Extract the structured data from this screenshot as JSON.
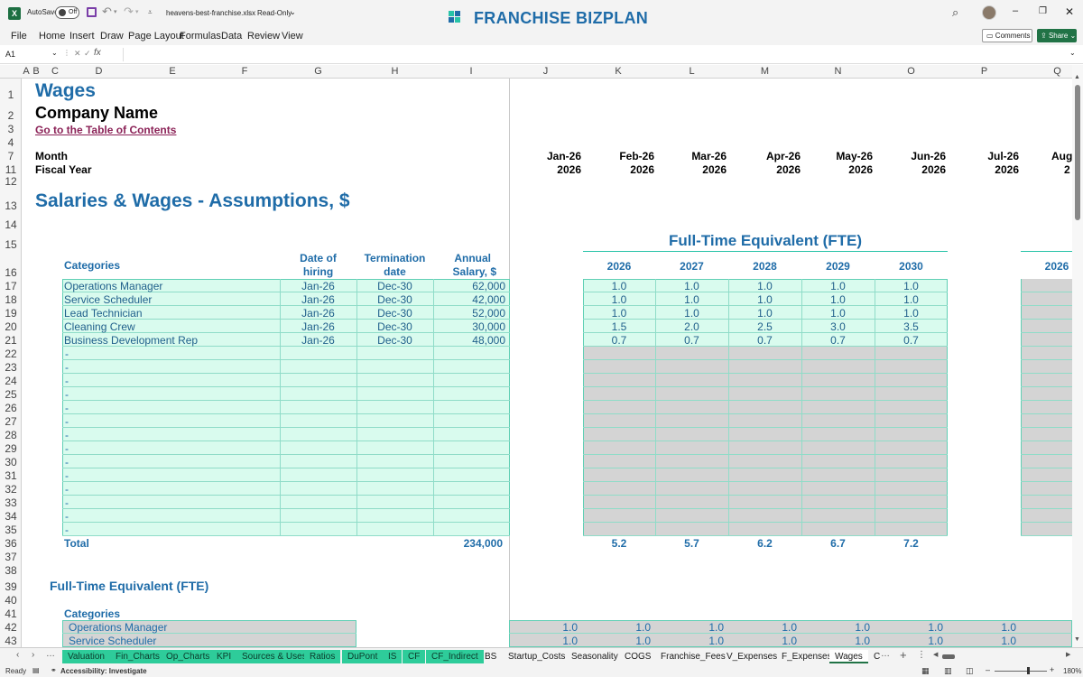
{
  "titlebar": {
    "autosave_label": "AutoSave",
    "autosave_state": "Off",
    "filename": "heavens-best-franchise.xlsx",
    "mode": "Read-Only",
    "brand": "FRANCHISE BIZPLAN"
  },
  "menu": [
    "File",
    "Home",
    "Insert",
    "Draw",
    "Page Layout",
    "Formulas",
    "Data",
    "Review",
    "View"
  ],
  "comments_label": "Comments",
  "share_label": "Share",
  "name_box": "A1",
  "fx_label": "fx",
  "columns": [
    "A",
    "B",
    "C",
    "D",
    "E",
    "F",
    "G",
    "H",
    "I",
    "J",
    "K",
    "L",
    "M",
    "N",
    "O",
    "P",
    "Q"
  ],
  "rows": [
    "1",
    "2",
    "3",
    "4",
    "7",
    "11",
    "12",
    "13",
    "14",
    "15",
    "16",
    "17",
    "18",
    "19",
    "20",
    "21",
    "22",
    "23",
    "24",
    "25",
    "26",
    "27",
    "28",
    "29",
    "30",
    "31",
    "32",
    "33",
    "34",
    "35",
    "36",
    "37",
    "38",
    "39",
    "40",
    "41",
    "42",
    "43"
  ],
  "sheet": {
    "title": "Wages",
    "company": "Company Name",
    "toc_link": "Go to the Table of Contents",
    "month_label": "Month",
    "fiscal_label": "Fiscal Year",
    "months": [
      "Jan-26",
      "Feb-26",
      "Mar-26",
      "Apr-26",
      "May-26",
      "Jun-26",
      "Jul-26",
      "Aug"
    ],
    "fiscal_years": [
      "2026",
      "2026",
      "2026",
      "2026",
      "2026",
      "2026",
      "2026",
      "2"
    ],
    "section_title": "Salaries & Wages - Assumptions, $",
    "fte_title": "Full-Time Equivalent (FTE)",
    "hdr_categories": "Categories",
    "hdr_date_l1": "Date of",
    "hdr_date_l2": "hiring",
    "hdr_term_l1": "Termination",
    "hdr_term_l2": "date",
    "hdr_salary_l1": "Annual",
    "hdr_salary_l2": "Salary, $",
    "fte_years": [
      "2026",
      "2027",
      "2028",
      "2029",
      "2030"
    ],
    "fte_extra_year": "2026",
    "employees": [
      {
        "name": "Operations Manager",
        "hire": "Jan-26",
        "term": "Dec-30",
        "salary": "62,000",
        "fte": [
          "1.0",
          "1.0",
          "1.0",
          "1.0",
          "1.0"
        ]
      },
      {
        "name": "Service Scheduler",
        "hire": "Jan-26",
        "term": "Dec-30",
        "salary": "42,000",
        "fte": [
          "1.0",
          "1.0",
          "1.0",
          "1.0",
          "1.0"
        ]
      },
      {
        "name": "Lead Technician",
        "hire": "Jan-26",
        "term": "Dec-30",
        "salary": "52,000",
        "fte": [
          "1.0",
          "1.0",
          "1.0",
          "1.0",
          "1.0"
        ]
      },
      {
        "name": "Cleaning Crew",
        "hire": "Jan-26",
        "term": "Dec-30",
        "salary": "30,000",
        "fte": [
          "1.5",
          "2.0",
          "2.5",
          "3.0",
          "3.5"
        ]
      },
      {
        "name": "Business Development Rep",
        "hire": "Jan-26",
        "term": "Dec-30",
        "salary": "48,000",
        "fte": [
          "0.7",
          "0.7",
          "0.7",
          "0.7",
          "0.7"
        ]
      }
    ],
    "empty_marker": "-",
    "total_label": "Total",
    "total_salary": "234,000",
    "total_fte": [
      "5.2",
      "5.7",
      "6.2",
      "6.7",
      "7.2"
    ],
    "fte2_title": "Full-Time Equivalent (FTE)",
    "fte2_categories": "Categories",
    "fte2_rows": [
      {
        "name": "Operations Manager",
        "values": [
          "1.0",
          "1.0",
          "1.0",
          "1.0",
          "1.0",
          "1.0",
          "1.0"
        ]
      },
      {
        "name": "Service Scheduler",
        "values": [
          "1.0",
          "1.0",
          "1.0",
          "1.0",
          "1.0",
          "1.0",
          "1.0"
        ]
      }
    ]
  },
  "tabs": [
    "Valuation",
    "Fin_Charts",
    "Op_Charts",
    "KPI",
    "Sources & Uses",
    "Ratios",
    "DuPont",
    "IS",
    "CF",
    "CF_Indirect",
    "BS",
    "Startup_Costs",
    "Seasonality",
    "COGS",
    "Franchise_Fees",
    "V_Expenses",
    "F_Expenses",
    "Wages",
    "C"
  ],
  "active_tab": "Wages",
  "status": {
    "ready": "Ready",
    "accessibility": "Accessibility: Investigate",
    "zoom": "180%"
  },
  "colors": {
    "accent": "#1f6ca8",
    "input_fill": "#d9fbee",
    "grey_fill": "#d4d4d4",
    "tab_green": "#2ecc9a",
    "link": "#8b2257"
  }
}
